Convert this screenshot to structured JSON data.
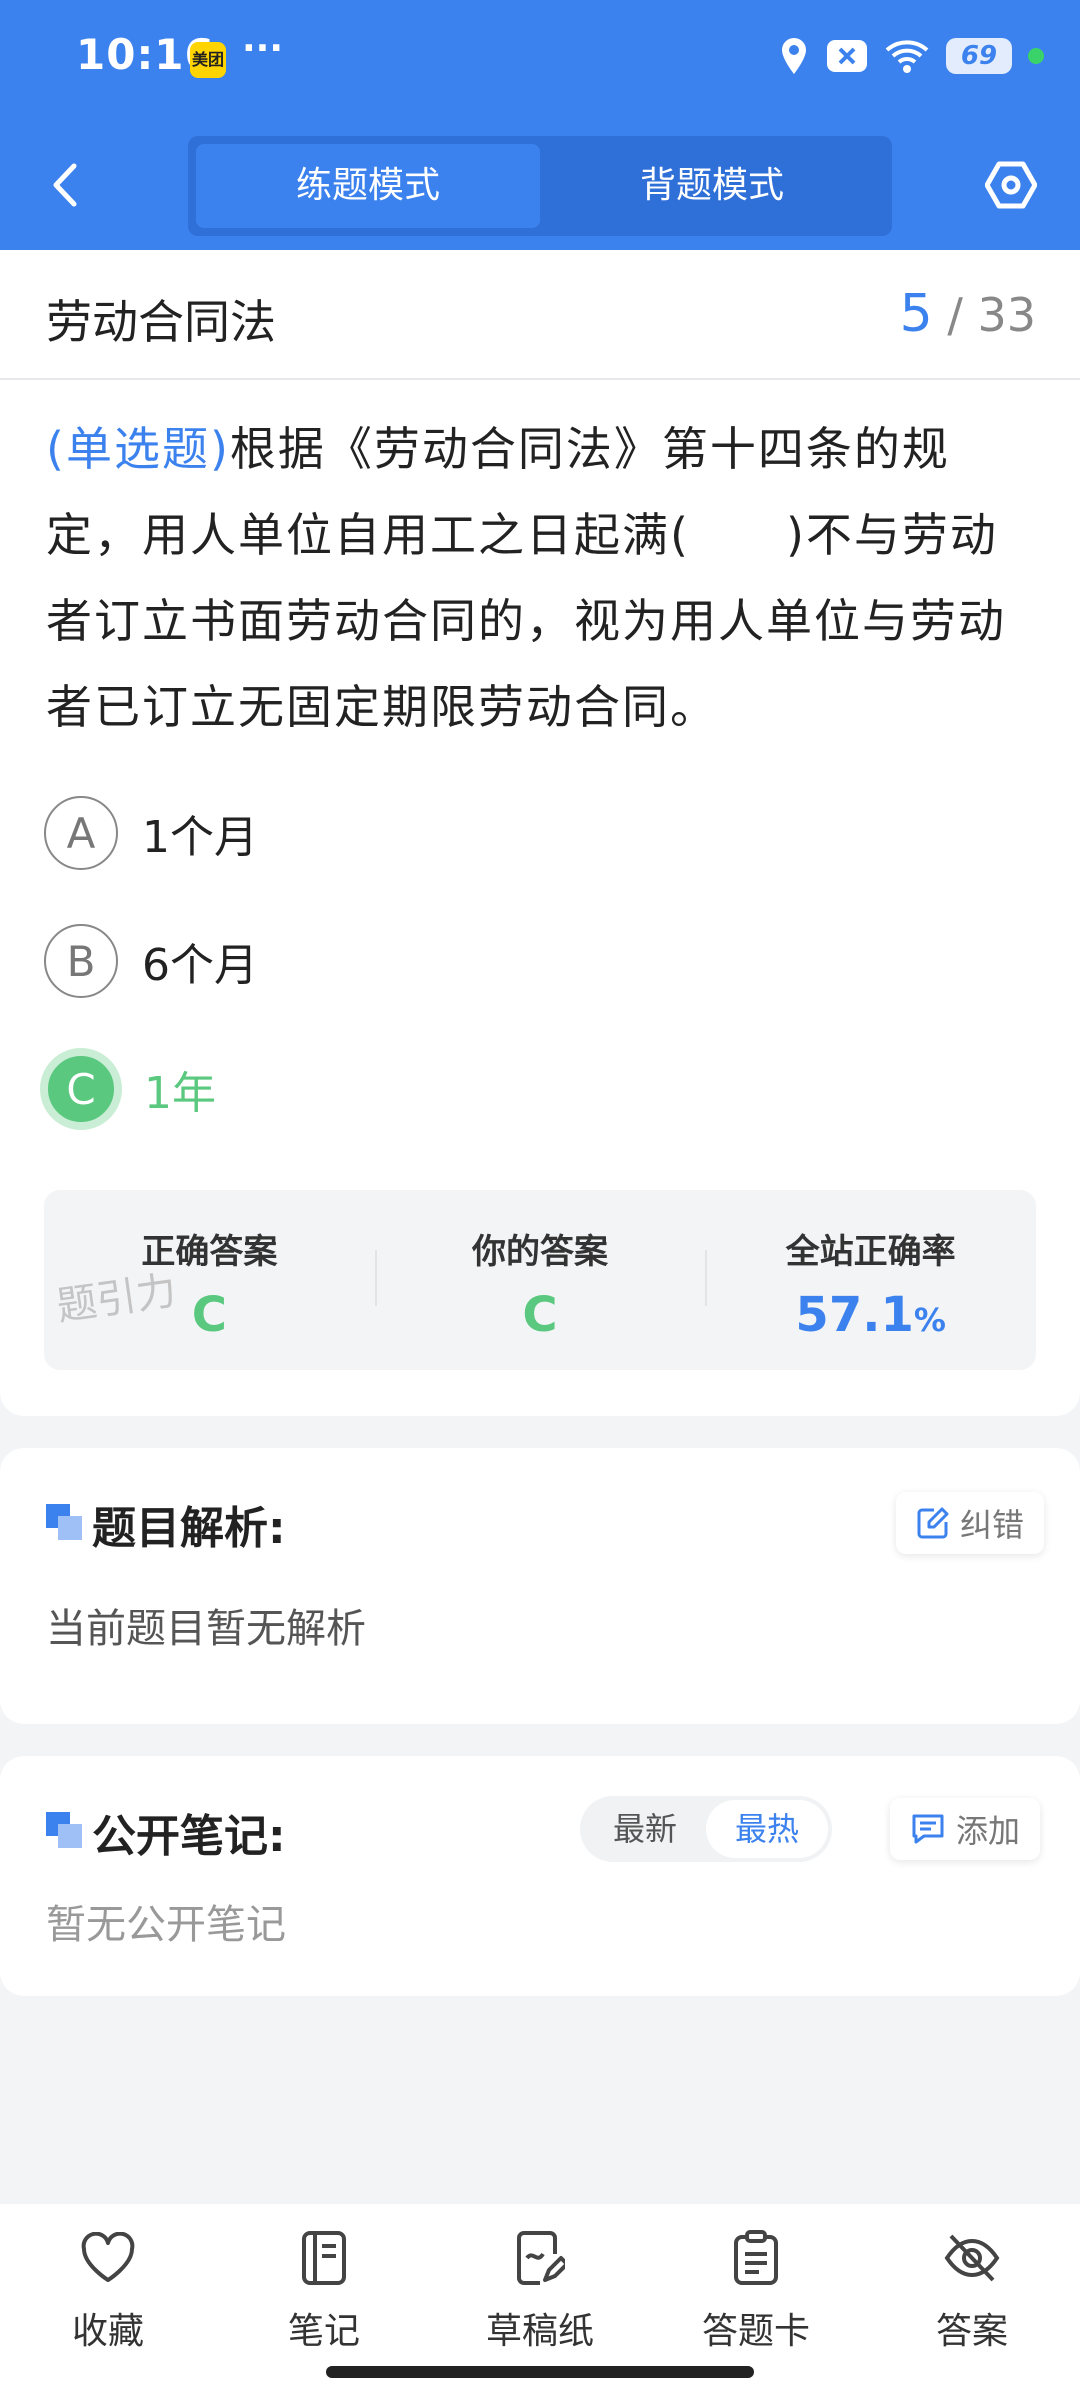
{
  "status_bar": {
    "time": "10:16",
    "app_badge": "美团",
    "more": "···",
    "battery": "69"
  },
  "header": {
    "modes": [
      {
        "label": "练题模式",
        "active": true
      },
      {
        "label": "背题模式",
        "active": false
      }
    ]
  },
  "titlebar": {
    "title": "劳动合同法",
    "current": "5",
    "separator": "/",
    "total": "33"
  },
  "question": {
    "type_label": "(单选题)",
    "text": "根据《劳动合同法》第十四条的规定，用人单位自用工之日起满(　　)不与劳动者订立书面劳动合同的，视为用人单位与劳动者已订立无固定期限劳动合同。",
    "options": [
      {
        "letter": "A",
        "text": "1个月",
        "state": "normal"
      },
      {
        "letter": "B",
        "text": "6个月",
        "state": "normal"
      },
      {
        "letter": "C",
        "text": "1年",
        "state": "correct"
      }
    ]
  },
  "result": {
    "correct_label": "正确答案",
    "correct_value": "C",
    "yours_label": "你的答案",
    "yours_value": "C",
    "rate_label": "全站正确率",
    "rate_value": "57.1",
    "rate_unit": "%",
    "watermark": "题引力"
  },
  "analysis": {
    "title": "题目解析:",
    "report_label": "纠错",
    "text": "当前题目暂无解析"
  },
  "notes": {
    "title": "公开笔记:",
    "sort_options": [
      {
        "label": "最新",
        "active": false
      },
      {
        "label": "最热",
        "active": true
      }
    ],
    "add_label": "添加",
    "empty_text": "暂无公开笔记"
  },
  "bottom_nav": [
    {
      "label": "收藏",
      "icon": "heart-icon"
    },
    {
      "label": "笔记",
      "icon": "notebook-icon"
    },
    {
      "label": "草稿纸",
      "icon": "draft-paper-icon"
    },
    {
      "label": "答题卡",
      "icon": "answer-card-icon"
    },
    {
      "label": "答案",
      "icon": "eye-off-icon"
    }
  ],
  "colors": {
    "primary": "#3c82ee",
    "correct": "#5ac87e"
  }
}
